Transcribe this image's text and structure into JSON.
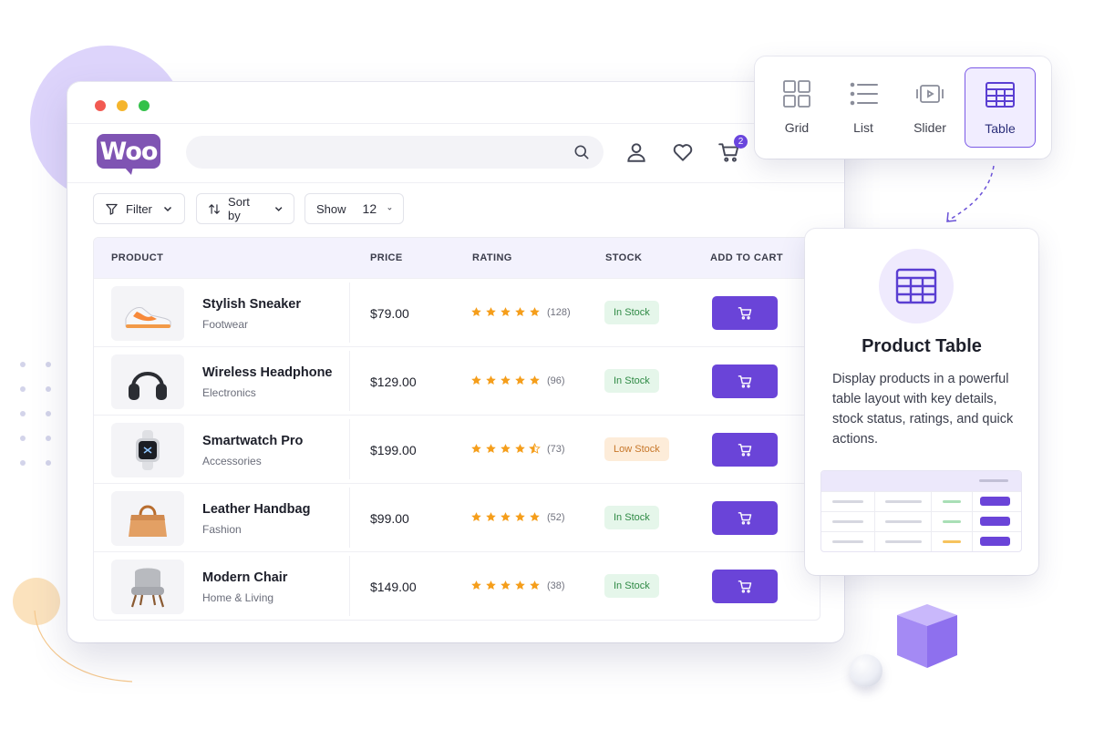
{
  "brand": {
    "logo_text": "Woo",
    "accent": "#6a44d8",
    "logo_color": "#7f54b3"
  },
  "header": {
    "cart_count": "2"
  },
  "toolbar": {
    "filter_label": "Filter",
    "sort_label": "Sort by",
    "show_label": "Show",
    "show_value": "12"
  },
  "table": {
    "columns": [
      "PRODUCT",
      "PRICE",
      "RATING",
      "STOCK",
      "ADD TO CART"
    ],
    "rows": [
      {
        "name": "Stylish Sneaker",
        "category": "Footwear",
        "price": "$79.00",
        "stars": 5,
        "reviews": "(128)",
        "stock": "In Stock",
        "stock_status": "in",
        "image_icon": "sneaker-image"
      },
      {
        "name": "Wireless Headphone",
        "category": "Electronics",
        "price": "$129.00",
        "stars": 5,
        "reviews": "(96)",
        "stock": "In Stock",
        "stock_status": "in",
        "image_icon": "headphone-image"
      },
      {
        "name": "Smartwatch Pro",
        "category": "Accessories",
        "price": "$199.00",
        "stars": 4.5,
        "reviews": "(73)",
        "stock": "Low Stock",
        "stock_status": "low",
        "image_icon": "smartwatch-image"
      },
      {
        "name": "Leather Handbag",
        "category": "Fashion",
        "price": "$99.00",
        "stars": 5,
        "reviews": "(52)",
        "stock": "In Stock",
        "stock_status": "in",
        "image_icon": "handbag-image"
      },
      {
        "name": "Modern Chair",
        "category": "Home & Living",
        "price": "$149.00",
        "stars": 5,
        "reviews": "(38)",
        "stock": "In Stock",
        "stock_status": "in",
        "image_icon": "chair-image"
      }
    ]
  },
  "view_switcher": {
    "items": [
      {
        "label": "Grid",
        "icon": "grid-icon"
      },
      {
        "label": "List",
        "icon": "list-icon"
      },
      {
        "label": "Slider",
        "icon": "slider-icon"
      },
      {
        "label": "Table",
        "icon": "table-icon",
        "active": true
      }
    ]
  },
  "info_card": {
    "title": "Product Table",
    "description": "Display products in a powerful table layout with key details, stock status, ratings, and quick actions."
  },
  "colors": {
    "in_stock": "#2f8a45",
    "low_stock": "#c7772a",
    "star": "#f59e1b"
  }
}
